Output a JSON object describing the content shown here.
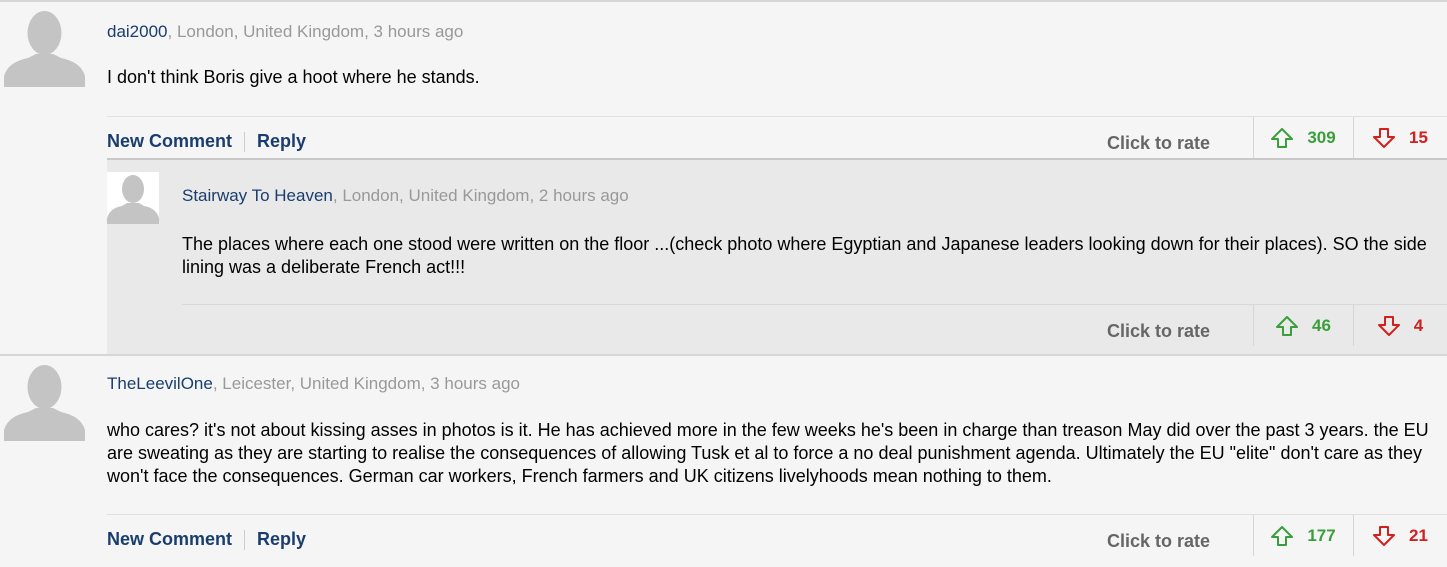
{
  "comments": [
    {
      "username": "dai2000",
      "location_time": ", London, United Kingdom, 3 hours ago",
      "text": "I don't think Boris give a hoot where he stands.",
      "new_comment_label": "New Comment",
      "reply_label": "Reply",
      "rate_label": "Click to rate",
      "upvotes": "309",
      "downvotes": "15",
      "reply": {
        "username": "Stairway To Heaven",
        "location_time": ", London, United Kingdom, 2 hours ago",
        "text": "The places where each one stood were written on the floor ...(check photo where Egyptian and Japanese leaders looking down for their places). SO the side lining was a deliberate French act!!!",
        "rate_label": "Click to rate",
        "upvotes": "46",
        "downvotes": "4"
      }
    },
    {
      "username": "TheLeevilOne",
      "location_time": ", Leicester, United Kingdom, 3 hours ago",
      "text": "who cares? it's not about kissing asses in photos is it. He has achieved more in the few weeks he's been in charge than treason May did over the past 3 years. the EU are sweating as they are starting to realise the consequences of allowing Tusk et al to force a no deal punishment agenda. Ultimately the EU \"elite\" don't care as they won't face the consequences. German car workers, French farmers and UK citizens livelyhoods mean nothing to them.",
      "new_comment_label": "New Comment",
      "reply_label": "Reply",
      "rate_label": "Click to rate",
      "upvotes": "177",
      "downvotes": "21"
    }
  ],
  "icons": {
    "avatar": "avatar-silhouette-icon",
    "up": "arrow-up-icon",
    "down": "arrow-down-icon"
  },
  "colors": {
    "username": "#1a3d6e",
    "upvote": "#3a9f3a",
    "downvote": "#d02020"
  }
}
